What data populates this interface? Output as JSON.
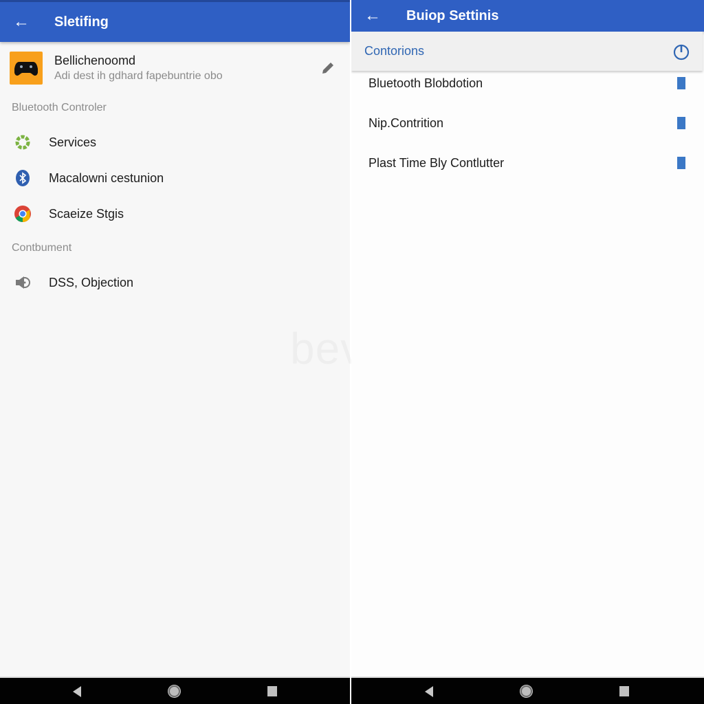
{
  "left_screen": {
    "appbar": {
      "back_icon": "arrow-left-icon",
      "title": "Sletifing"
    },
    "profile": {
      "icon": "gamepad-icon",
      "icon_color": "#f8a01c",
      "title": "Bellichenoomd",
      "subtitle": "Adi dest ih gdhard fapebuntrie obo",
      "edit_icon": "pencil-icon"
    },
    "sections": [
      {
        "header": "Bluetooth Controler",
        "items": [
          {
            "icon": "services-gear-icon",
            "label": "Services"
          },
          {
            "icon": "bluetooth-icon",
            "label": "Macalowni cestunion"
          },
          {
            "icon": "chrome-icon",
            "label": "Scaeize Stgis"
          }
        ]
      },
      {
        "header": "Contbument",
        "items": [
          {
            "icon": "speaker-icon",
            "label": "DSS, Objection"
          }
        ]
      }
    ],
    "watermark": "beview"
  },
  "right_screen": {
    "appbar": {
      "back_icon": "arrow-left-icon",
      "title": "Buiop Settinis"
    },
    "subbar": {
      "title": "Contorions",
      "power_icon": "power-icon"
    },
    "items": [
      {
        "label": "Bluetooth Blobdotion"
      },
      {
        "label": "Nip.Contrition"
      },
      {
        "label": "Plast Time Bly Contlutter"
      }
    ],
    "accent_color": "#3b78c6"
  },
  "navbar": {
    "back": "nav-back-icon",
    "home": "nav-home-icon",
    "recents": "nav-recents-icon"
  },
  "colors": {
    "appbar": "#2f5fc4",
    "subbar_text": "#2f66b3"
  }
}
